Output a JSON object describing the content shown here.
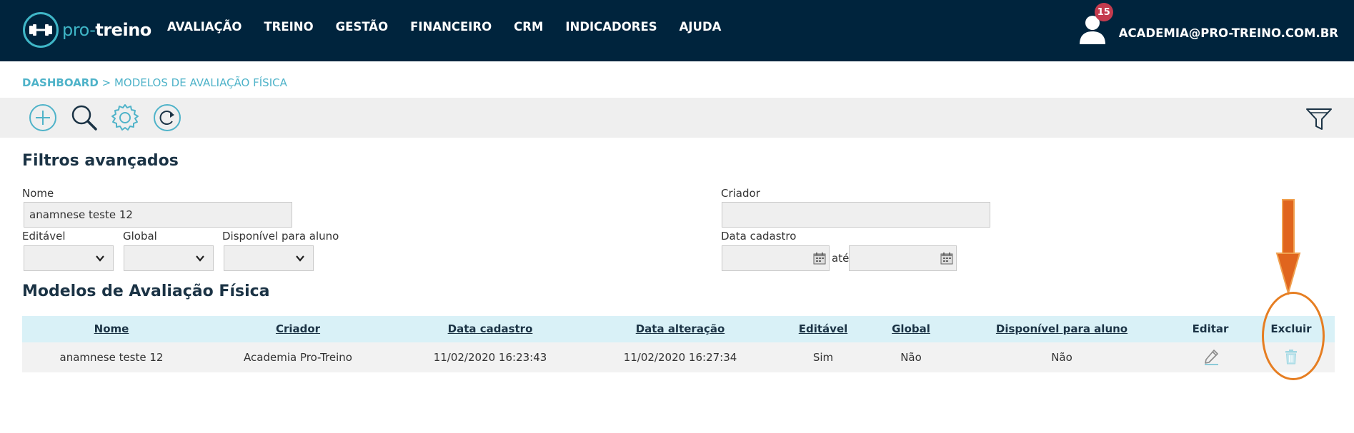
{
  "app": {
    "logo_text_part1": "pro-",
    "logo_text_part2": "treino",
    "brand_color": "#3fb6c7",
    "topbar_color": "#00243d"
  },
  "nav": {
    "items": [
      {
        "label": "AVALIAÇÃO"
      },
      {
        "label": "TREINO"
      },
      {
        "label": "GESTÃO"
      },
      {
        "label": "FINANCEIRO"
      },
      {
        "label": "CRM"
      },
      {
        "label": "INDICADORES"
      },
      {
        "label": "AJUDA"
      }
    ]
  },
  "user": {
    "notification_count": "15",
    "email": "ACADEMIA@PRO-TREINO.COM.BR"
  },
  "breadcrumb": {
    "root": "DASHBOARD",
    "separator": ">",
    "current": "MODELOS DE AVALIAÇÃO FÍSICA"
  },
  "toolbar": {
    "icons": [
      "plus-circle-icon",
      "search-icon",
      "gear-icon",
      "refresh-icon",
      "filter-icon"
    ]
  },
  "filters": {
    "title": "Filtros avançados",
    "nome_label": "Nome",
    "nome_value": "anamnese teste 12",
    "criador_label": "Criador",
    "criador_value": "",
    "editavel_label": "Editável",
    "global_label": "Global",
    "disponivel_label": "Disponível para aluno",
    "data_cadastro_label": "Data cadastro",
    "ate_label": "até"
  },
  "table": {
    "title": "Modelos de Avaliação Física",
    "headers": {
      "nome": "Nome",
      "criador": "Criador",
      "data_cadastro": "Data cadastro",
      "data_alteracao": "Data alteração",
      "editavel": "Editável",
      "global": "Global",
      "disponivel": "Disponível para aluno",
      "editar": "Editar",
      "excluir": "Excluir"
    },
    "rows": [
      {
        "nome": "anamnese teste 12",
        "criador": "Academia Pro-Treino",
        "data_cadastro": "11/02/2020 16:23:43",
        "data_alteracao": "11/02/2020 16:27:34",
        "editavel": "Sim",
        "global": "Não",
        "disponivel": "Não"
      }
    ]
  },
  "annotation": {
    "color": "#e67e22"
  }
}
